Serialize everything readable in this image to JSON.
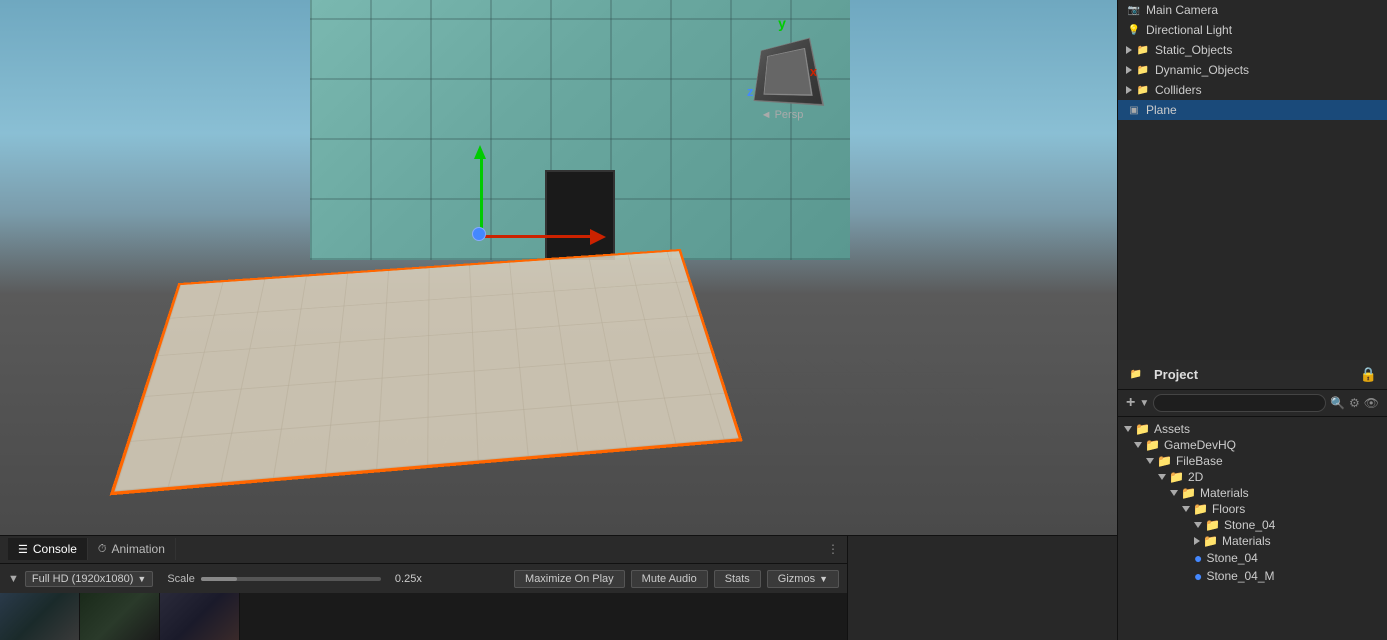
{
  "hierarchy": {
    "items": [
      {
        "id": "main-camera",
        "label": "Main Camera",
        "indent": 0,
        "icon": "camera",
        "selected": false
      },
      {
        "id": "directional-light",
        "label": "Directional Light",
        "indent": 0,
        "icon": "light",
        "selected": false
      },
      {
        "id": "static-objects",
        "label": "Static_Objects",
        "indent": 0,
        "icon": "folder",
        "expanded": true,
        "selected": false
      },
      {
        "id": "dynamic-objects",
        "label": "Dynamic_Objects",
        "indent": 0,
        "icon": "folder",
        "expanded": true,
        "selected": false
      },
      {
        "id": "colliders",
        "label": "Colliders",
        "indent": 0,
        "icon": "folder",
        "expanded": false,
        "selected": false
      },
      {
        "id": "plane",
        "label": "Plane",
        "indent": 0,
        "icon": "mesh",
        "selected": true
      }
    ]
  },
  "project": {
    "title": "Project",
    "search_placeholder": "",
    "tree": [
      {
        "id": "assets",
        "label": "Assets",
        "indent": 0,
        "type": "folder-open"
      },
      {
        "id": "gamedevhq",
        "label": "GameDevHQ",
        "indent": 1,
        "type": "folder-open"
      },
      {
        "id": "filebase",
        "label": "FileBase",
        "indent": 2,
        "type": "folder-open"
      },
      {
        "id": "2d",
        "label": "2D",
        "indent": 3,
        "type": "folder-open"
      },
      {
        "id": "materials",
        "label": "Materials",
        "indent": 4,
        "type": "folder-open"
      },
      {
        "id": "floors",
        "label": "Floors",
        "indent": 5,
        "type": "folder-open"
      },
      {
        "id": "stone04",
        "label": "Stone_04",
        "indent": 6,
        "type": "folder-open"
      },
      {
        "id": "materials2",
        "label": "Materials",
        "indent": 6,
        "type": "folder"
      },
      {
        "id": "stone04-asset",
        "label": "Stone_04",
        "indent": 6,
        "type": "material"
      },
      {
        "id": "stone04m",
        "label": "Stone_04_M",
        "indent": 6,
        "type": "material"
      }
    ]
  },
  "bottom": {
    "tabs": [
      {
        "id": "console",
        "label": "Console",
        "icon": "☰",
        "active": true
      },
      {
        "id": "animation",
        "label": "Animation",
        "icon": "⏱",
        "active": false
      }
    ],
    "more_icon": "⋮",
    "playback": {
      "resolution_label": "Full HD (1920x1080)",
      "scale_label": "Scale",
      "scale_value": "0.25x",
      "maximize_on_play": "Maximize On Play",
      "mute_audio": "Mute Audio",
      "stats": "Stats",
      "gizmos": "Gizmos",
      "gizmos_arrow": "▼"
    }
  },
  "orientation": {
    "y_label": "y",
    "x_label": "x",
    "z_label": "z",
    "persp_label": "◄ Persp"
  }
}
